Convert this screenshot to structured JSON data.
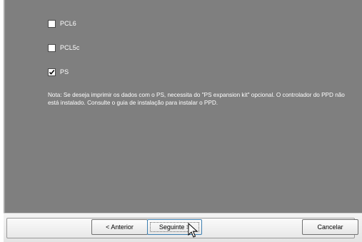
{
  "options": [
    {
      "label": "PCL6",
      "checked": false
    },
    {
      "label": "PCL5c",
      "checked": false
    },
    {
      "label": "PS",
      "checked": true
    }
  ],
  "note": "Nota: Se deseja imprimir os dados com o PS, necessita do \"PS expansion kit\" opcional. O controlador do PPD não está instalado. Consulte o guia de instalação para instalar o PPD.",
  "buttons": {
    "back_label": "< Anterior",
    "next_label": "Seguinte >",
    "cancel_label": "Cancelar"
  },
  "colors": {
    "panel_bg": "#7f7f7f",
    "focus_border": "#3c7fb1"
  },
  "icons": {
    "pointer": "mouse-pointer-icon",
    "checkmark": "checkmark-icon"
  }
}
